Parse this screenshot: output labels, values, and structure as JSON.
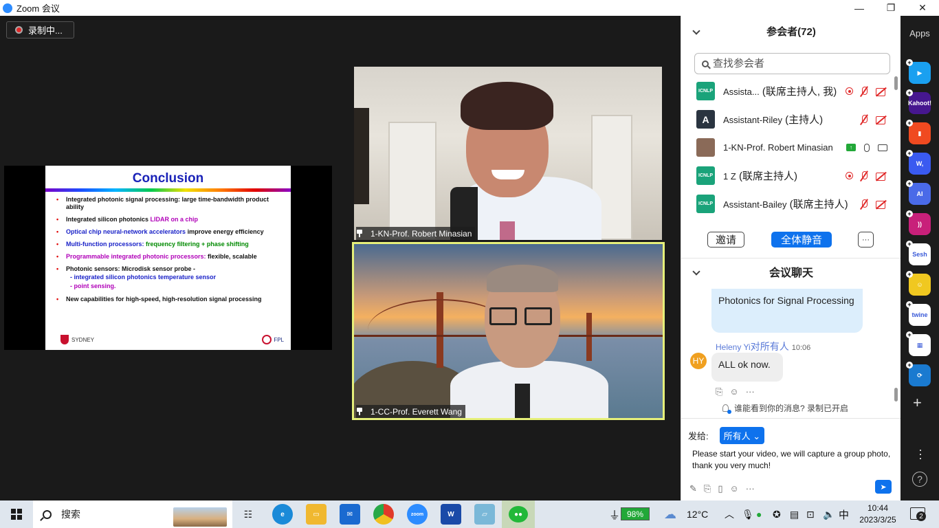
{
  "window": {
    "title": "Zoom 会议",
    "minimize": "—",
    "restore": "❐",
    "close": "✕"
  },
  "recording": {
    "label": "录制中..."
  },
  "slide": {
    "title": "Conclusion",
    "bullets": [
      {
        "parts": [
          [
            "Integrated photonic signal processing: large time-bandwidth product ability",
            ""
          ]
        ]
      },
      {
        "parts": [
          [
            "Integrated silicon photonics ",
            ""
          ],
          [
            "LIDAR on a chip",
            "mag"
          ]
        ]
      },
      {
        "parts": [
          [
            "Optical chip neural-network accelerators",
            "blu"
          ],
          [
            " improve energy efficiency",
            ""
          ]
        ]
      },
      {
        "parts": [
          [
            "Multi-function processors: ",
            "blu"
          ],
          [
            "frequency filtering + phase shifting",
            "grn"
          ]
        ]
      },
      {
        "parts": [
          [
            "Programmable integrated photonic processors:",
            "mag"
          ],
          [
            " flexible, scalable",
            ""
          ]
        ]
      },
      {
        "parts": [
          [
            "Photonic sensors: Microdisk sensor probe -",
            ""
          ]
        ],
        "subs": [
          [
            "- integrated silicon photonics temperature sensor",
            "blu"
          ],
          [
            "- point sensing.",
            "mag"
          ]
        ]
      },
      {
        "parts": [
          [
            "New capabilities for high-speed, high-resolution signal processing",
            ""
          ]
        ]
      }
    ],
    "footer_left": "SYDNEY",
    "footer_right": "FPL"
  },
  "videos": [
    {
      "name": "1-KN-Prof. Robert Minasian"
    },
    {
      "name": "1-CC-Prof. Everett Wang"
    }
  ],
  "participants": {
    "title": "参会者(72)",
    "search_placeholder": "查找参会者",
    "list": [
      {
        "name": "Assista...",
        "role": " (联席主持人, 我)",
        "avatar": "ICNLP",
        "avatar_color": "#1aa37a",
        "icons": [
          "rec",
          "mic-off",
          "cam-off"
        ]
      },
      {
        "name": "Assistant-Riley",
        "role": " (主持人)",
        "avatar": "A",
        "avatar_color": "#2a3440",
        "icons": [
          "mic-off",
          "cam-off"
        ]
      },
      {
        "name": "1-KN-Prof. Robert Minasian",
        "role": "",
        "avatar": "",
        "avatar_color": "#8a6a58",
        "icons": [
          "share",
          "mic",
          "cam"
        ]
      },
      {
        "name": "1 Z",
        "role": " (联席主持人)",
        "avatar": "ICNLP",
        "avatar_color": "#1aa37a",
        "icons": [
          "rec",
          "mic-off",
          "cam-off"
        ]
      },
      {
        "name": "Assistant-Bailey",
        "role": " (联席主持人)",
        "avatar": "ICNLP",
        "avatar_color": "#1aa37a",
        "icons": [
          "mic-off",
          "cam-off"
        ]
      }
    ],
    "invite": "邀请",
    "mute_all": "全体静音",
    "more": "···"
  },
  "chat": {
    "title": "会议聊天",
    "msg1": "Photonics for Signal Processing",
    "sender": "Heleny Yi",
    "sender_to": "对所有人",
    "time": "10:06",
    "avatar": "HY",
    "msg2": "ALL ok now.",
    "notice": "谁能看到你的消息? 录制已开启",
    "send_to_label": "发给:",
    "send_to_value": "所有人",
    "compose_text": "Please start your video, we will capture a group photo, thank you very much!"
  },
  "apps": {
    "title": "Apps",
    "items": [
      {
        "label": "▶",
        "color": "#1aa0f0"
      },
      {
        "label": "Kahoot!",
        "color": "#46178f"
      },
      {
        "label": "▮",
        "color": "#f04a20"
      },
      {
        "label": "W,",
        "color": "#3a5af0"
      },
      {
        "label": "AI",
        "color": "#4a6ae8"
      },
      {
        "label": "))",
        "color": "#c8207a"
      },
      {
        "label": "Sesh",
        "color": "#ffffff"
      },
      {
        "label": "☺",
        "color": "#f0c820"
      },
      {
        "label": "twine",
        "color": "#ffffff"
      },
      {
        "label": "▦",
        "color": "#ffffff"
      },
      {
        "label": "⟳",
        "color": "#1a7ad0"
      }
    ]
  },
  "taskbar": {
    "search": "搜索",
    "battery": "98%",
    "weather": "12°C",
    "ime": "中",
    "time": "10:44",
    "date": "2023/3/25",
    "notifications": "2"
  }
}
